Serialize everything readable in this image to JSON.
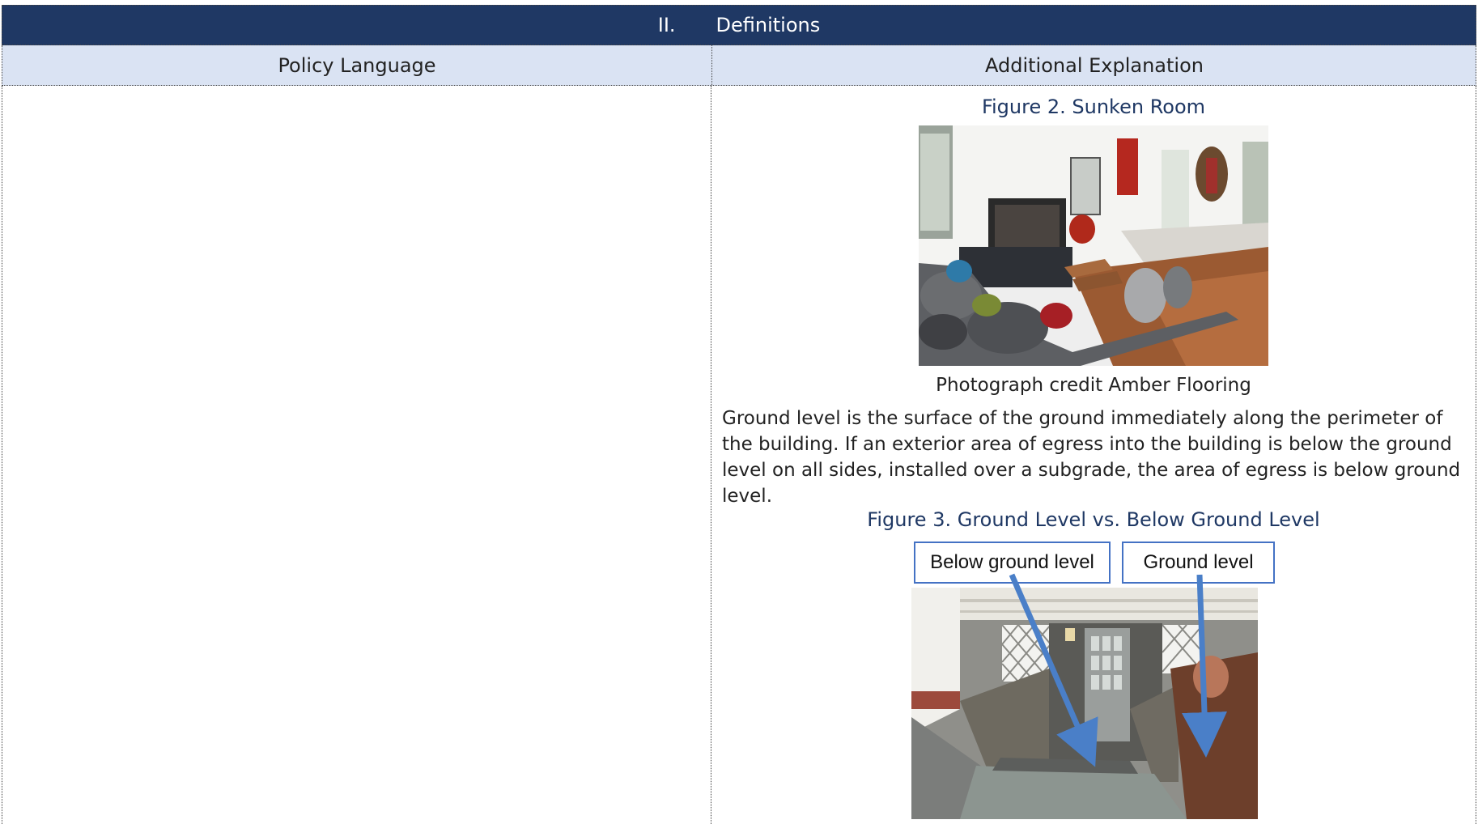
{
  "section": {
    "number": "II.",
    "title": "Definitions"
  },
  "columns": {
    "left": "Policy Language",
    "right": "Additional Explanation"
  },
  "figure2": {
    "title": "Figure 2. Sunken Room",
    "credit": "Photograph credit Amber Flooring"
  },
  "paragraph": "Ground level is the surface of the ground immediately along the perimeter of the building. If an exterior area of egress into the building is below the ground level on all sides, installed over a subgrade, the area of egress is below ground level.",
  "figure3": {
    "title": "Figure 3. Ground Level vs. Below Ground Level",
    "label_below": "Below ground level",
    "label_ground": "Ground level"
  },
  "colors": {
    "header_bg": "#1f3864",
    "subheader_bg": "#dae3f3",
    "figure_title": "#1f3864",
    "arrow": "#4a7fc8"
  }
}
